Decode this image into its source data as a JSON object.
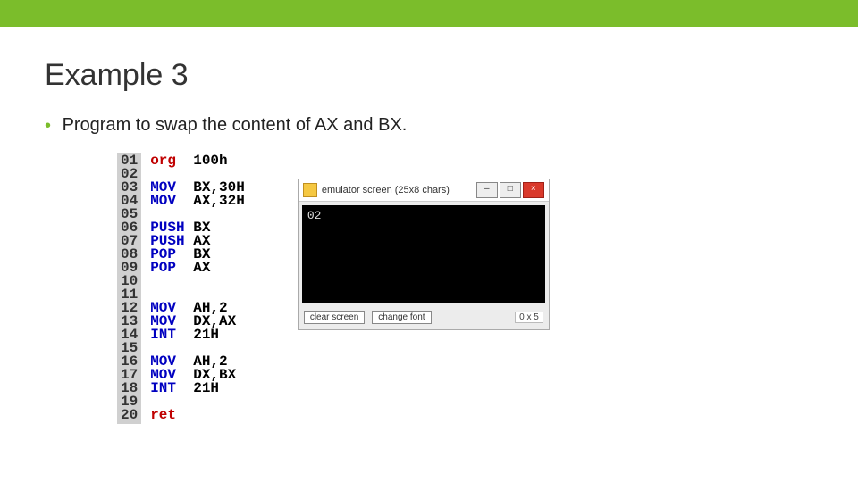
{
  "header": {
    "accent_color": "#7bbd2b"
  },
  "title": "Example 3",
  "bullet": {
    "glyph": "•",
    "text": "Program to swap the content of AX and BX."
  },
  "code": {
    "lines": [
      {
        "n": "01",
        "inst": "org",
        "args": "100h",
        "kind": "kw"
      },
      {
        "n": "02",
        "inst": "",
        "args": "",
        "kind": ""
      },
      {
        "n": "03",
        "inst": "MOV",
        "args": "BX,30H",
        "kind": "inst"
      },
      {
        "n": "04",
        "inst": "MOV",
        "args": "AX,32H",
        "kind": "inst"
      },
      {
        "n": "05",
        "inst": "",
        "args": "",
        "kind": ""
      },
      {
        "n": "06",
        "inst": "PUSH",
        "args": "BX",
        "kind": "inst"
      },
      {
        "n": "07",
        "inst": "PUSH",
        "args": "AX",
        "kind": "inst"
      },
      {
        "n": "08",
        "inst": "POP",
        "args": "BX",
        "kind": "inst"
      },
      {
        "n": "09",
        "inst": "POP",
        "args": "AX",
        "kind": "inst"
      },
      {
        "n": "10",
        "inst": "",
        "args": "",
        "kind": ""
      },
      {
        "n": "11",
        "inst": "",
        "args": "",
        "kind": ""
      },
      {
        "n": "12",
        "inst": "MOV",
        "args": "AH,2",
        "kind": "inst"
      },
      {
        "n": "13",
        "inst": "MOV",
        "args": "DX,AX",
        "kind": "inst"
      },
      {
        "n": "14",
        "inst": "INT",
        "args": "21H",
        "kind": "inst"
      },
      {
        "n": "15",
        "inst": "",
        "args": "",
        "kind": ""
      },
      {
        "n": "16",
        "inst": "MOV",
        "args": "AH,2",
        "kind": "inst"
      },
      {
        "n": "17",
        "inst": "MOV",
        "args": "DX,BX",
        "kind": "inst"
      },
      {
        "n": "18",
        "inst": "INT",
        "args": "21H",
        "kind": "inst"
      },
      {
        "n": "19",
        "inst": "",
        "args": "",
        "kind": ""
      },
      {
        "n": "20",
        "inst": "ret",
        "args": "",
        "kind": "kw"
      }
    ]
  },
  "emulator": {
    "title": "emulator screen (25x8 chars)",
    "output": "02",
    "buttons": {
      "clear": "clear screen",
      "font": "change font"
    },
    "coords": "0 x 5",
    "window": {
      "min": "–",
      "max": "□",
      "close": "×"
    }
  }
}
